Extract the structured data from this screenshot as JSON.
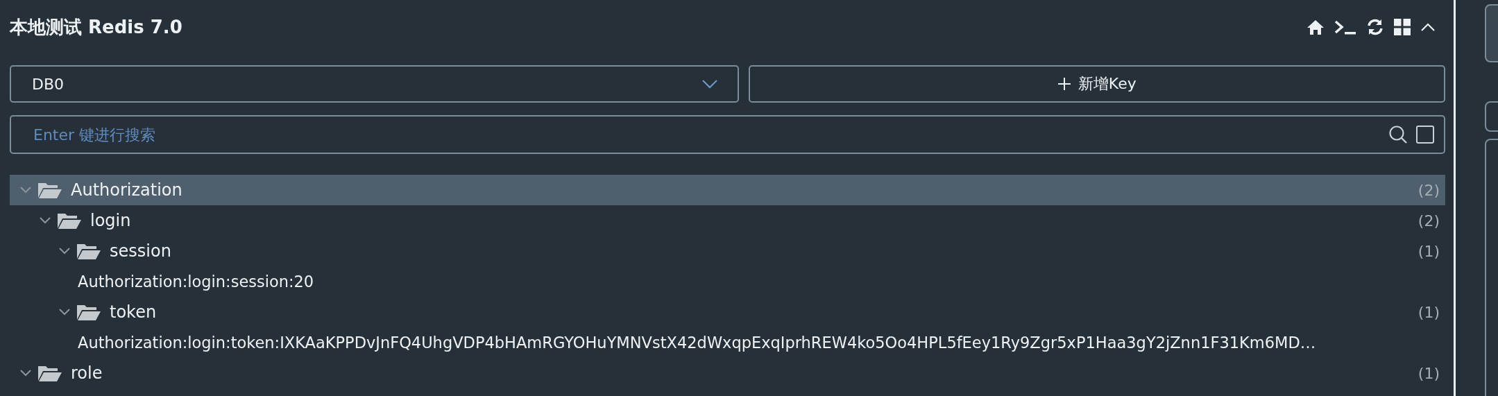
{
  "header": {
    "title": "本地测试 Redis 7.0"
  },
  "db_select": {
    "value": "DB0"
  },
  "add_button": {
    "label": "新增Key"
  },
  "search": {
    "placeholder": "Enter 键进行搜索",
    "exact_match": {
      "checked": false
    }
  },
  "tree": [
    {
      "kind": "folder",
      "name": "Authorization",
      "count": "(2)",
      "expanded": true,
      "selected": true,
      "children": [
        {
          "kind": "folder",
          "name": "login",
          "count": "(2)",
          "expanded": true,
          "selected": false,
          "children": [
            {
              "kind": "folder",
              "name": "session",
              "count": "(1)",
              "expanded": true,
              "selected": false,
              "children": [
                {
                  "kind": "key",
                  "name": "Authorization:login:session:20",
                  "selected": false
                }
              ]
            },
            {
              "kind": "folder",
              "name": "token",
              "count": "(1)",
              "expanded": true,
              "selected": false,
              "children": [
                {
                  "kind": "key",
                  "name": "Authorization:login:token:IXKAaKPPDvJnFQ4UhgVDP4bHAmRGYOHuYMNVstX42dWxqpExqIprhREW4ko5Oo4HPL5fEey1Ry9Zgr5xP1Haa3gY2jZnn1F31Km6MD…",
                  "selected": false
                }
              ]
            }
          ]
        }
      ]
    },
    {
      "kind": "folder",
      "name": "role",
      "count": "(1)",
      "expanded": true,
      "selected": false
    }
  ]
}
